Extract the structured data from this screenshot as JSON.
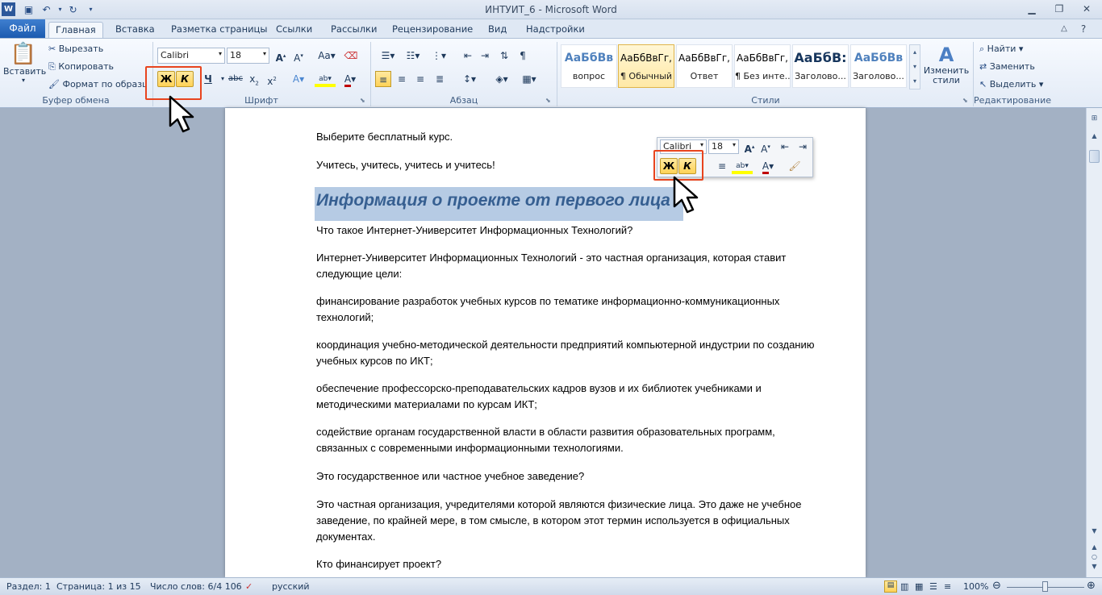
{
  "window": {
    "title": "ИНТУИТ_6 - Microsoft Word",
    "app_icon": "word-icon"
  },
  "quick_access": [
    "save-icon",
    "undo-icon",
    "redo-icon",
    "customize-icon"
  ],
  "tabs": [
    {
      "label": "Файл"
    },
    {
      "label": "Главная"
    },
    {
      "label": "Вставка"
    },
    {
      "label": "Разметка страницы"
    },
    {
      "label": "Ссылки"
    },
    {
      "label": "Рассылки"
    },
    {
      "label": "Рецензирование"
    },
    {
      "label": "Вид"
    },
    {
      "label": "Надстройки"
    }
  ],
  "clipboard": {
    "paste": "Вставить",
    "cut": "Вырезать",
    "copy": "Копировать",
    "format_painter": "Формат по образцу",
    "label": "Буфер обмена"
  },
  "font": {
    "name": "Calibri",
    "size": "18",
    "bold": "Ж",
    "italic": "К",
    "label": "Шрифт"
  },
  "paragraph": {
    "label": "Абзац"
  },
  "styles": {
    "label": "Стили",
    "items": [
      {
        "preview": "АаБбВв",
        "name": "вопрос"
      },
      {
        "preview": "АаБбВвГг,",
        "name": "¶ Обычный"
      },
      {
        "preview": "АаБбВвГг,",
        "name": "Ответ"
      },
      {
        "preview": "АаБбВвГг,",
        "name": "¶ Без инте..."
      },
      {
        "preview": "АаБбВ:",
        "name": "Заголово..."
      },
      {
        "preview": "АаБбВв",
        "name": "Заголово..."
      }
    ],
    "change": "Изменить стили"
  },
  "editing": {
    "label": "Редактирование",
    "find": "Найти",
    "replace": "Заменить",
    "select": "Выделить"
  },
  "document": {
    "p0": "Выберите бесплатный курс.",
    "p1": "Учитесь, учитесь, учитесь и учитесь!",
    "heading": "Информация о проекте от первого лица",
    "p2": "Что такое Интернет-Университет Информационных Технологий?",
    "p3": "Интернет-Университет Информационных Технологий - это частная организация, которая ставит следующие цели:",
    "p4": "финансирование разработок учебных курсов по тематике информационно-коммуникационных технологий;",
    "p5": "координация учебно-методической деятельности предприятий компьютерной индустрии по созданию учебных курсов по ИКТ;",
    "p6": "обеспечение профессорско-преподавательских кадров вузов и их библиотек учебниками и методическими материалами по курсам ИКТ;",
    "p7": "содействие органам государственной власти в области развития образовательных программ, связанных с современными информационными технологиями.",
    "p8": "Это государственное или частное учебное заведение?",
    "p9": "Это частная организация, учредителями которой являются физические лица. Это даже не учебное заведение, по крайней мере, в том смысле, в котором этот термин используется в официальных документах.",
    "p10": "Кто финансирует проект?"
  },
  "mini_toolbar": {
    "font": "Calibri",
    "size": "18",
    "bold": "Ж",
    "italic": "К"
  },
  "status": {
    "section": "Раздел: 1",
    "page": "Страница: 1 из 15",
    "words": "Число слов: 6/4 106",
    "lang": "русский",
    "zoom": "100%"
  },
  "colors": {
    "accent": "#2b579a",
    "highlight_box": "#e8441e",
    "selection": "#b6cbe4"
  }
}
